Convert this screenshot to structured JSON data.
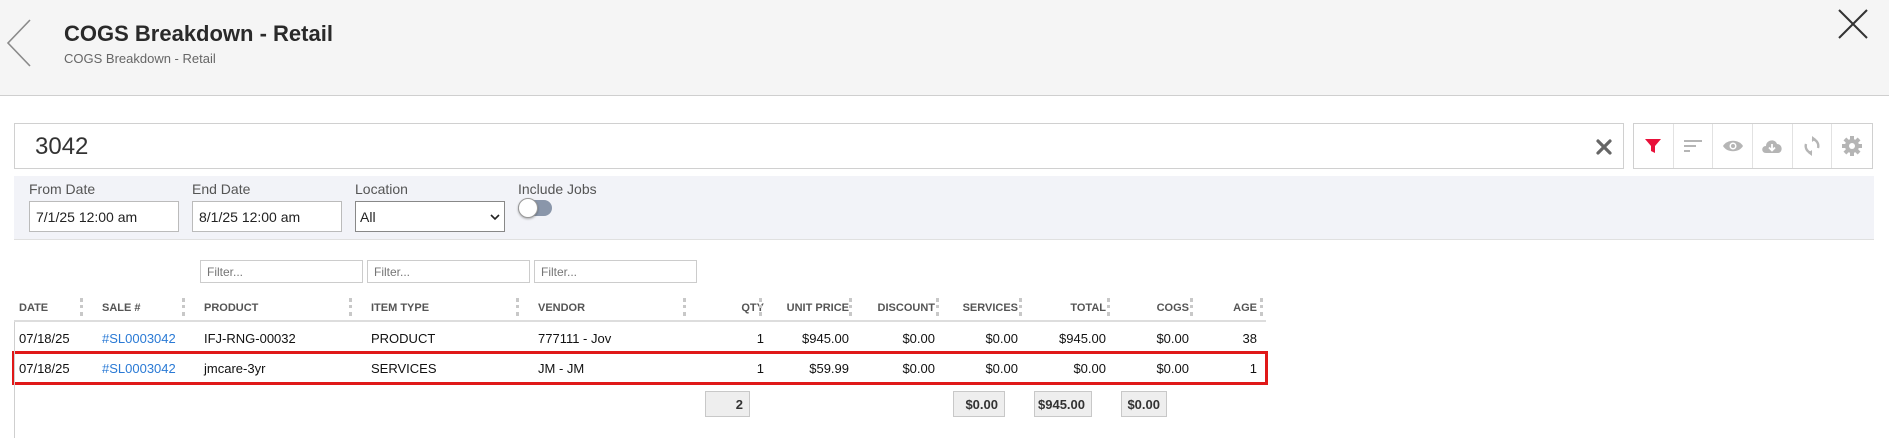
{
  "header": {
    "title": "COGS Breakdown - Retail",
    "subtitle": "COGS Breakdown - Retail"
  },
  "search": {
    "value": "3042"
  },
  "toolbar": {
    "icons": [
      "filter-icon",
      "sort-icon",
      "eye-icon",
      "cloud-download-icon",
      "refresh-icon",
      "gear-icon"
    ],
    "active_color": "#e8113a",
    "inactive_color": "#b5b5b5"
  },
  "filters": {
    "from_date_label": "From Date",
    "from_date_value": "7/1/25 12:00 am",
    "end_date_label": "End Date",
    "end_date_value": "8/1/25 12:00 am",
    "location_label": "Location",
    "location_value": "All",
    "include_jobs_label": "Include Jobs",
    "include_jobs_on": false
  },
  "column_filters": {
    "placeholder": "Filter..."
  },
  "table": {
    "columns": [
      "DATE",
      "SALE #",
      "PRODUCT",
      "ITEM TYPE",
      "VENDOR",
      "QTY",
      "UNIT PRICE",
      "DISCOUNT",
      "SERVICES",
      "TOTAL",
      "COGS",
      "AGE"
    ],
    "rows": [
      {
        "date": "07/18/25",
        "sale": "#SL0003042",
        "product": "IFJ-RNG-00032",
        "item_type": "PRODUCT",
        "vendor": "777111 - Jov",
        "qty": "1",
        "unit_price": "$945.00",
        "discount": "$0.00",
        "services": "$0.00",
        "total": "$945.00",
        "cogs": "$0.00",
        "age": "38"
      },
      {
        "date": "07/18/25",
        "sale": "#SL0003042",
        "product": "jmcare-3yr",
        "item_type": "SERVICES",
        "vendor": "JM - JM",
        "qty": "1",
        "unit_price": "$59.99",
        "discount": "$0.00",
        "services": "$0.00",
        "total": "$0.00",
        "cogs": "$0.00",
        "age": "1"
      }
    ],
    "selected_row_index": 1,
    "selection_color": "#e01818",
    "link_color": "#2a7ad5",
    "totals": {
      "qty": "2",
      "services": "$0.00",
      "total": "$945.00",
      "cogs": "$0.00"
    }
  }
}
